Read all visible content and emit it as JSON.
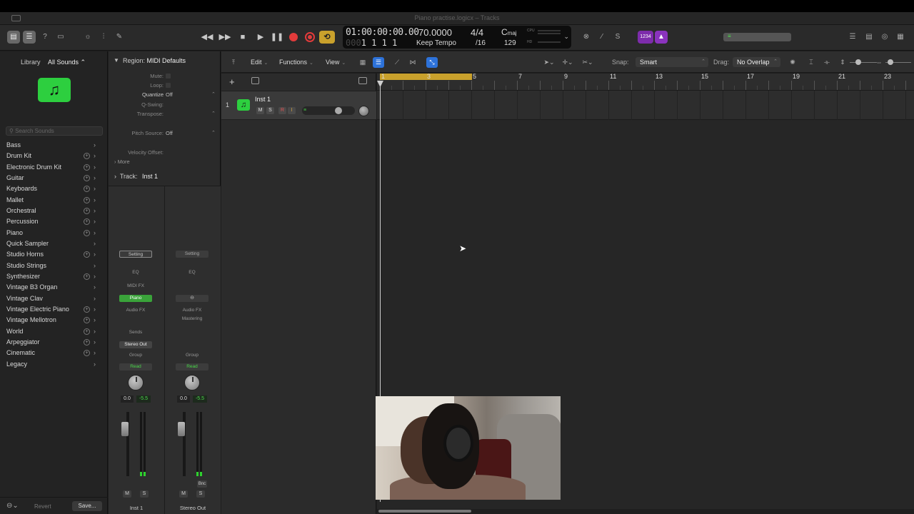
{
  "window": {
    "title": "Piano practise.logicx – Tracks"
  },
  "lcd": {
    "timecode": "01:00:00:00.00",
    "bar_position_dim": "000",
    "bar_position": "1  1  1    1",
    "tempo": "70.0000",
    "tempo_mode": "Keep Tempo",
    "time_signature": "4/4",
    "division": "/16",
    "key": "C",
    "key_mode": "maj",
    "key_value": "129",
    "cpu_label": "CPU",
    "hd_label": "HD"
  },
  "control_bar": {
    "count_in": "1234"
  },
  "library": {
    "label": "Library",
    "filter": "All Sounds ⌃",
    "search_placeholder": "Search Sounds",
    "items": [
      {
        "label": "Bass",
        "plus": false
      },
      {
        "label": "Drum Kit",
        "plus": true
      },
      {
        "label": "Electronic Drum Kit",
        "plus": true
      },
      {
        "label": "Guitar",
        "plus": true
      },
      {
        "label": "Keyboards",
        "plus": true
      },
      {
        "label": "Mallet",
        "plus": true
      },
      {
        "label": "Orchestral",
        "plus": true
      },
      {
        "label": "Percussion",
        "plus": true
      },
      {
        "label": "Piano",
        "plus": true
      },
      {
        "label": "Quick Sampler",
        "plus": false
      },
      {
        "label": "Studio Horns",
        "plus": true
      },
      {
        "label": "Studio Strings",
        "plus": false
      },
      {
        "label": "Synthesizer",
        "plus": true
      },
      {
        "label": "Vintage B3 Organ",
        "plus": false
      },
      {
        "label": "Vintage Clav",
        "plus": false
      },
      {
        "label": "Vintage Electric Piano",
        "plus": true
      },
      {
        "label": "Vintage Mellotron",
        "plus": true
      },
      {
        "label": "World",
        "plus": true
      },
      {
        "label": "Arpeggiator",
        "plus": true
      },
      {
        "label": "Cinematic",
        "plus": true
      },
      {
        "label": "Legacy",
        "plus": false
      }
    ],
    "revert_label": "Revert",
    "save_label": "Save..."
  },
  "inspector": {
    "region_label": "Region:",
    "region_name": "MIDI Defaults",
    "mute_label": "Mute:",
    "loop_label": "Loop:",
    "quantize_label": "Quantize",
    "quantize_value": "Off",
    "qswing_label": "Q-Swing:",
    "transpose_label": "Transpose:",
    "pitch_source_label": "Pitch Source:",
    "pitch_source_value": "Off",
    "velocity_label": "Velocity Offset:",
    "more_label": "More",
    "track_label": "Track:",
    "track_name": "Inst 1",
    "strip1": {
      "setting": "Setting",
      "eq": "EQ",
      "midi_fx": "MIDI FX",
      "instrument": "Piano",
      "audio_fx": "Audio FX",
      "sends": "Sends",
      "output": "Stereo Out",
      "group": "Group",
      "automation": "Read",
      "volume": "0.0",
      "peak": "-5.5",
      "mute": "M",
      "solo": "S",
      "name": "Inst 1"
    },
    "strip2": {
      "setting": "Setting",
      "eq": "EQ",
      "link": "⊖",
      "audio_fx": "Audio FX",
      "mastering": "Mastering",
      "group": "Group",
      "automation": "Read",
      "volume": "0.0",
      "peak": "-5.5",
      "bounce": "Bnc",
      "mute": "M",
      "solo": "S",
      "name": "Stereo Out"
    }
  },
  "tracks_toolbar": {
    "edit": "Edit",
    "functions": "Functions",
    "view": "View",
    "snap_label": "Snap:",
    "snap_value": "Smart",
    "drag_label": "Drag:",
    "drag_value": "No Overlap"
  },
  "tracks": [
    {
      "number": "1",
      "name": "Inst 1",
      "mute": "M",
      "solo": "S",
      "record": "R",
      "input": "I"
    }
  ],
  "ruler": {
    "bars": [
      "1",
      "3",
      "5",
      "7",
      "9",
      "11",
      "13",
      "15",
      "17",
      "19",
      "21",
      "23"
    ]
  }
}
